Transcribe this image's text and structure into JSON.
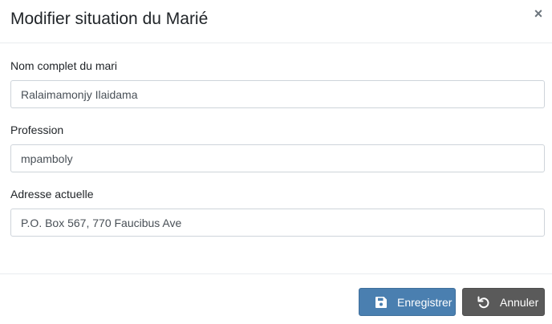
{
  "header": {
    "title": "Modifier situation du Marié",
    "close_glyph": "×"
  },
  "form": {
    "fields": [
      {
        "label": "Nom complet du mari",
        "value": "Ralaimamonjy Ilaidama"
      },
      {
        "label": "Profession",
        "value": "mpamboly"
      },
      {
        "label": "Adresse actuelle",
        "value": "P.O. Box 567, 770 Faucibus Ave"
      }
    ]
  },
  "footer": {
    "save_label": "Enregistrer",
    "save_icon": "floppy-disk-icon",
    "cancel_label": "Annuler",
    "cancel_icon": "undo-icon"
  },
  "colors": {
    "save_button": "#4a7fb0",
    "cancel_button": "#5a5a5a"
  }
}
